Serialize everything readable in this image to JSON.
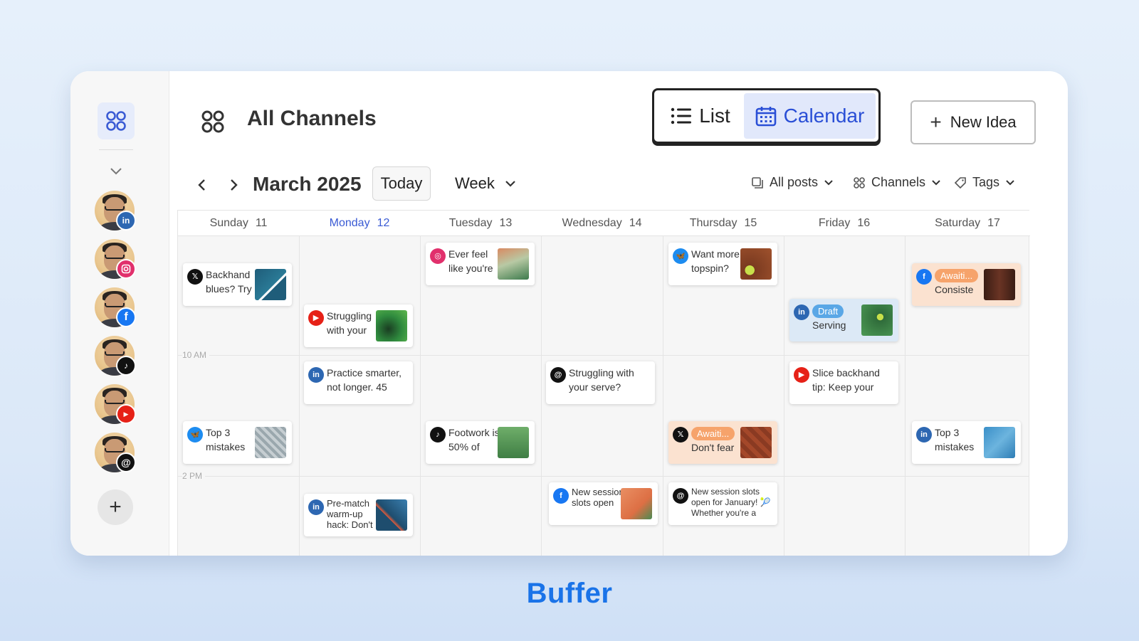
{
  "header": {
    "title": "All Channels",
    "view_list": "List",
    "view_calendar": "Calendar",
    "new_idea": "New Idea"
  },
  "toolbar": {
    "month": "March 2025",
    "today": "Today",
    "range": "Week",
    "filters": [
      "All posts",
      "Channels",
      "Tags"
    ]
  },
  "sidebar": {
    "channels": [
      {
        "network": "linkedin",
        "color": "#2d67b2"
      },
      {
        "network": "instagram",
        "color": "#e1306c"
      },
      {
        "network": "facebook",
        "color": "#1877f2"
      },
      {
        "network": "tiktok",
        "color": "#111111"
      },
      {
        "network": "youtube",
        "color": "#e62117"
      },
      {
        "network": "threads",
        "color": "#111111"
      }
    ]
  },
  "days": [
    {
      "name": "Sunday",
      "num": "11"
    },
    {
      "name": "Monday",
      "num": "12",
      "active": true
    },
    {
      "name": "Tuesday",
      "num": "13"
    },
    {
      "name": "Wednesday",
      "num": "14"
    },
    {
      "name": "Thursday",
      "num": "15"
    },
    {
      "name": "Friday",
      "num": "16"
    },
    {
      "name": "Saturday",
      "num": "17"
    }
  ],
  "time_labels": [
    "10 AM",
    "2 PM"
  ],
  "posts": [
    {
      "network": "x",
      "text": "Backhand blues? Try"
    },
    {
      "network": "bluesky",
      "text": "Top 3 mistakes"
    },
    {
      "network": "youtube",
      "text": "Struggling with your"
    },
    {
      "network": "linkedin",
      "text": "Practice smarter, not longer. 45"
    },
    {
      "network": "linkedin",
      "text": "Pre-match warm-up hack: Don't"
    },
    {
      "network": "instagram",
      "text": "Ever feel like you're"
    },
    {
      "network": "tiktok",
      "text": "Footwork is 50% of"
    },
    {
      "network": "threads",
      "text": "Struggling with your serve?"
    },
    {
      "network": "facebook",
      "text": "New session slots open"
    },
    {
      "network": "bluesky",
      "text": "Want more topspin?"
    },
    {
      "network": "x",
      "tag": "Awaiti...",
      "text": "Don't fear"
    },
    {
      "network": "threads",
      "text": "New session slots open for January! 🎾 Whether you're a"
    },
    {
      "network": "linkedin",
      "tag": "Draft",
      "text": "Serving"
    },
    {
      "network": "youtube",
      "text": "Slice backhand tip: Keep your"
    },
    {
      "network": "facebook",
      "tag": "Awaiti...",
      "text": "Consiste"
    },
    {
      "network": "linkedin",
      "text": "Top 3 mistakes"
    }
  ],
  "brand": "Buffer",
  "colors": {
    "accent": "#2a4fd6",
    "awaiting": "#f6a36b",
    "draft": "#5aa7e6",
    "brand": "#1a73e8"
  }
}
